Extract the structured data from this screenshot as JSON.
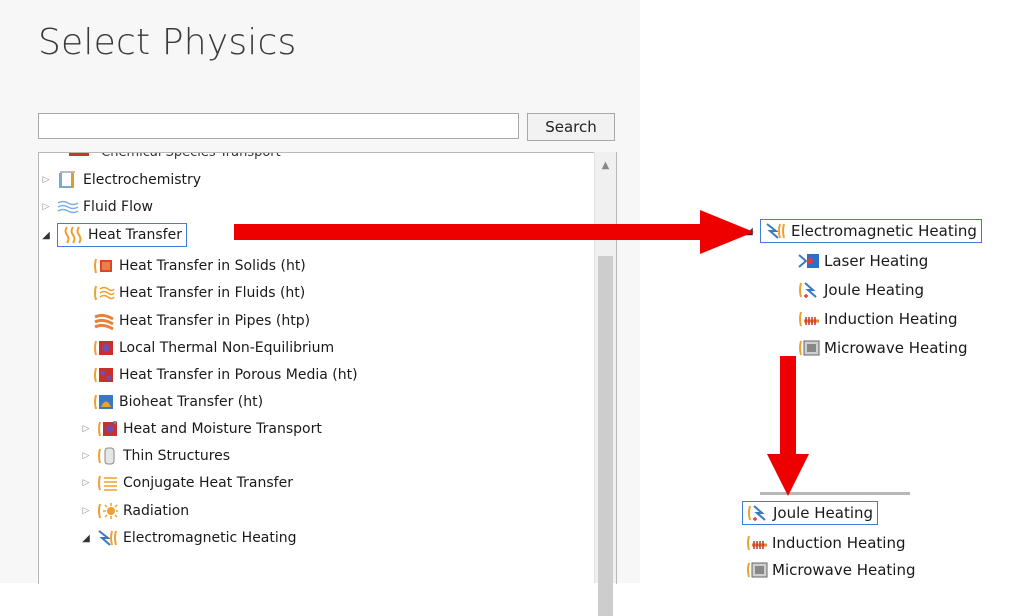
{
  "header": {
    "title": "Select Physics"
  },
  "search": {
    "value": "",
    "button_label": "Search"
  },
  "tree": {
    "cutoff_label": "Chemical Species Transport",
    "items": [
      {
        "label": "Electrochemistry",
        "icon": "electrochemistry-icon"
      },
      {
        "label": "Fluid Flow",
        "icon": "fluid-flow-icon"
      },
      {
        "label": "Heat Transfer",
        "icon": "heat-transfer-icon"
      },
      {
        "label": "Heat Transfer in Solids (ht)",
        "icon": "heat-solids-icon"
      },
      {
        "label": "Heat Transfer in Fluids (ht)",
        "icon": "heat-fluids-icon"
      },
      {
        "label": "Heat Transfer in Pipes (htp)",
        "icon": "heat-pipes-icon"
      },
      {
        "label": "Local Thermal Non-Equilibrium",
        "icon": "thermal-noneq-icon"
      },
      {
        "label": "Heat Transfer in Porous Media (ht)",
        "icon": "porous-media-icon"
      },
      {
        "label": "Bioheat Transfer (ht)",
        "icon": "bioheat-icon"
      },
      {
        "label": "Heat and Moisture Transport",
        "icon": "moisture-icon"
      },
      {
        "label": "Thin Structures",
        "icon": "thin-structures-icon"
      },
      {
        "label": "Conjugate Heat Transfer",
        "icon": "conjugate-icon"
      },
      {
        "label": "Radiation",
        "icon": "radiation-icon"
      },
      {
        "label": "Electromagnetic Heating",
        "icon": "em-heating-icon"
      }
    ]
  },
  "zoom1": {
    "parent": "Electromagnetic Heating",
    "children": [
      "Laser Heating",
      "Joule Heating",
      "Induction Heating",
      "Microwave Heating"
    ]
  },
  "zoom2": {
    "children": [
      "Joule Heating",
      "Induction Heating",
      "Microwave Heating"
    ]
  },
  "colors": {
    "arrow": "#ee0000",
    "selection_border": "#3c7fd6",
    "heat_orange": "#f0a030"
  }
}
